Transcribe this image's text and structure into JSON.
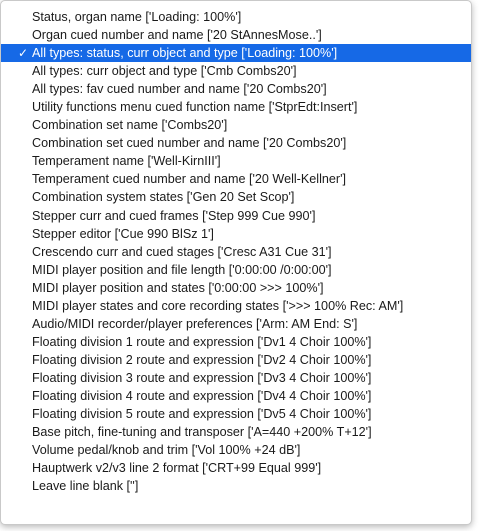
{
  "menu": {
    "items": [
      {
        "label": "Status, organ name ['Loading: 100%']",
        "checked": false
      },
      {
        "label": "Organ cued number and name ['20 StAnnesMose..']",
        "checked": false
      },
      {
        "label": "All types: status, curr object and type ['Loading: 100%']",
        "checked": true
      },
      {
        "label": "All types: curr object and type ['Cmb Combs20']",
        "checked": false
      },
      {
        "label": "All types: fav cued number and name ['20 Combs20']",
        "checked": false
      },
      {
        "label": "Utility functions menu cued function name ['StprEdt:Insert']",
        "checked": false
      },
      {
        "label": "Combination set name ['Combs20']",
        "checked": false
      },
      {
        "label": "Combination set cued number and name ['20 Combs20']",
        "checked": false
      },
      {
        "label": "Temperament name ['Well-KirnIII']",
        "checked": false
      },
      {
        "label": "Temperament cued number and name ['20 Well-Kellner']",
        "checked": false
      },
      {
        "label": "Combination system states ['Gen 20  Set Scop']",
        "checked": false
      },
      {
        "label": "Stepper curr and cued frames ['Step 999 Cue 990']",
        "checked": false
      },
      {
        "label": "Stepper editor ['Cue 990 BlSz 1']",
        "checked": false
      },
      {
        "label": "Crescendo curr and cued stages ['Cresc A31 Cue 31']",
        "checked": false
      },
      {
        "label": "MIDI player position and file length ['0:00:00 /0:00:00']",
        "checked": false
      },
      {
        "label": "MIDI player position and states ['0:00:00 >>> 100%']",
        "checked": false
      },
      {
        "label": "MIDI player states and core recording states ['>>> 100% Rec: AM']",
        "checked": false
      },
      {
        "label": "Audio/MIDI recorder/player preferences ['Arm: AM End: S']",
        "checked": false
      },
      {
        "label": "Floating division 1 route and expression ['Dv1 4 Choir 100%']",
        "checked": false
      },
      {
        "label": "Floating division 2 route and expression ['Dv2 4 Choir 100%']",
        "checked": false
      },
      {
        "label": "Floating division 3 route and expression ['Dv3 4 Choir 100%']",
        "checked": false
      },
      {
        "label": "Floating division 4 route and expression ['Dv4 4 Choir 100%']",
        "checked": false
      },
      {
        "label": "Floating division 5 route and expression ['Dv5 4 Choir 100%']",
        "checked": false
      },
      {
        "label": "Base pitch, fine-tuning and transposer ['A=440 +200% T+12']",
        "checked": false
      },
      {
        "label": "Volume pedal/knob and trim ['Vol 100% +24 dB']",
        "checked": false
      },
      {
        "label": "Hauptwerk v2/v3 line 2 format ['CRT+99 Equal 999']",
        "checked": false
      },
      {
        "label": "Leave line blank ['']",
        "checked": false
      }
    ],
    "check_glyph": "✓",
    "selection_color": "#1669e6"
  }
}
